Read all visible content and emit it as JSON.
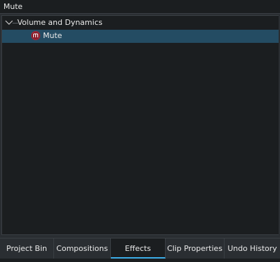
{
  "search": {
    "value": "Mute"
  },
  "tree": {
    "group": {
      "label": "Volume and Dynamics",
      "expanded": true,
      "icon": "chevron-down-icon"
    },
    "items": [
      {
        "label": "Mute",
        "icon": "mute-effect-icon",
        "selected": true
      }
    ]
  },
  "tabs": [
    {
      "label": "Project Bin"
    },
    {
      "label": "Compositions"
    },
    {
      "label": "Effects",
      "active": true
    },
    {
      "label": "Clip Properties"
    },
    {
      "label": "Undo History"
    }
  ],
  "colors": {
    "accent": "#3daee9",
    "selection": "#244c63",
    "mute_icon": "#8a1d2b"
  }
}
